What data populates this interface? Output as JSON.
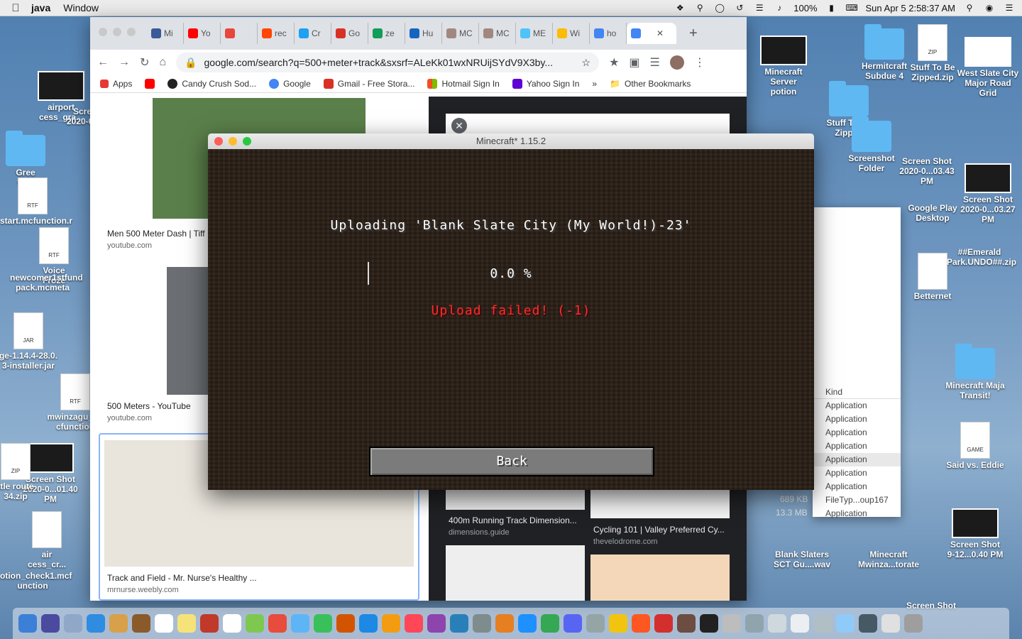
{
  "menubar": {
    "app_name": "java",
    "menus": [
      "Window"
    ],
    "battery": "100%",
    "clock": "Sun Apr 5  2:58:37 AM"
  },
  "desktop": {
    "left_items": [
      "airport\ncess_gra...",
      "Scre\n2020-02",
      "Gree\nv0.5",
      "start.mcfunction.r",
      "Voice\nFroze",
      "newcomer1stfund\npack.mcmeta",
      "ge-1.14.4-28.0.\n3-installer.jar",
      "mwinzagu_op\ncfunction",
      "Screen Shot\n2020-0...01.40 PM",
      "ttle route\n34.zip",
      "air\ncess_cr...",
      "otion_check1.mcf\nunction"
    ],
    "right_items": [
      "Minecraft Server\npotion",
      "Hermitcraft\nSubdue 4",
      "Stuff To Be\nZipped.zip",
      "West Slate City\nMajor Road Grid",
      "Stuff To Be\nZipped",
      "Screenshot\nFolder",
      "Screen Shot\n2020-0...03.43 PM",
      "Google Play\nDesktop",
      "Screen Shot\n2020-0...03.27 PM",
      "##Emerald\nPark.UNDO##.zip",
      "Betternet",
      "Minecraft Maja\nTransit!",
      "Said vs. Eddie",
      "Blank Slaters\nSCT Gu....wav",
      "Minecraft\nMwinza...torate",
      "Screen Shot\n9-12...0.40 PM",
      "Screen Shot"
    ]
  },
  "chrome": {
    "tabs": [
      "Mi",
      "Yo",
      "",
      "rec",
      "Cr",
      "Go",
      "ze",
      "Hu",
      "MC",
      "MC",
      "ME",
      "Wi",
      "ho",
      ""
    ],
    "tab_colors": [
      "#3b5998",
      "#ff0000",
      "#e8453c",
      "#ff4500",
      "#1da1f2",
      "#d93025",
      "#0f9d58",
      "#1565c0",
      "#a1887f",
      "#a1887f",
      "#4fc3f7",
      "#fbbc05",
      "#4285f4",
      "#4285f4"
    ],
    "url": "google.com/search?q=500+meter+track&sxsrf=ALeKk01wxNRUijSYdV9X3by...",
    "bookmarks": [
      "Apps",
      "Candy Crush Sod...",
      "Google",
      "Gmail - Free Stora...",
      "Hotmail Sign In",
      "Yahoo Sign In"
    ],
    "other_bookmarks": "Other Bookmarks",
    "results": [
      {
        "title": "Men 500 Meter Dash | Tiff",
        "source": "youtube.com"
      },
      {
        "title": "500 Meters - YouTube",
        "source": "youtube.com"
      },
      {
        "title": "Track and Field - Mr. Nurse's Healthy ...",
        "source": "mrnurse.weebly.com"
      },
      {
        "title": "400m Running Track Dimension...",
        "source": "dimensions.guide"
      },
      {
        "title": "Cycling 101 | Valley Preferred Cy...",
        "source": "thevelodrome.com"
      }
    ]
  },
  "finder": {
    "column_header": "Kind",
    "kinds": [
      "Application",
      "Application",
      "Application",
      "Application",
      "Application",
      "Application",
      "Application",
      "FileTyp...oup167",
      "Application"
    ],
    "sizes": [
      "689 KB",
      "13.3 MB"
    ]
  },
  "minecraft": {
    "window_title": "Minecraft* 1.15.2",
    "uploading_text": "Uploading 'Blank Slate City (My World!)-23'",
    "progress_text": "0.0 %",
    "progress": 0,
    "error_text": "Upload failed! (-1)",
    "back_label": "Back"
  }
}
